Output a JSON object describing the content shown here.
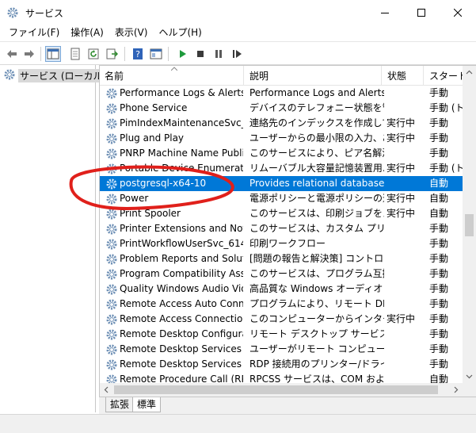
{
  "window": {
    "title": "サービス",
    "accent": "#0078d7"
  },
  "menu": [
    {
      "label": "ファイル(F)",
      "name": "menu-file"
    },
    {
      "label": "操作(A)",
      "name": "menu-action"
    },
    {
      "label": "表示(V)",
      "name": "menu-view"
    },
    {
      "label": "ヘルプ(H)",
      "name": "menu-help"
    }
  ],
  "tree": {
    "root_label": "サービス (ローカル)"
  },
  "columns": {
    "name": "名前",
    "description": "説明",
    "status": "状態",
    "startup": "スタートア"
  },
  "rows": [
    {
      "name": "Performance Logs & Alerts",
      "desc": "Performance Logs and Alerts...",
      "status": "",
      "startup": "手動"
    },
    {
      "name": "Phone Service",
      "desc": "デバイスのテレフォニー状態を管...",
      "status": "",
      "startup": "手動 (ト"
    },
    {
      "name": "PimIndexMaintenanceSvc_6...",
      "desc": "連絡先のインデックスを作成して...",
      "status": "実行中",
      "startup": "手動"
    },
    {
      "name": "Plug and Play",
      "desc": "ユーザーからの最小限の入力、あ...",
      "status": "実行中",
      "startup": "手動"
    },
    {
      "name": "PNRP Machine Name Publi...",
      "desc": "このサービスにより、ピア名解決プ...",
      "status": "",
      "startup": "手動"
    },
    {
      "name": "Portable Device Enumerator...",
      "desc": "リムーバブル大容量記憶装置用...",
      "status": "実行中",
      "startup": "手動 (ト"
    },
    {
      "name": "postgresql-x64-10",
      "desc": "Provides relational database ...",
      "status": "",
      "startup": "自動",
      "selected": true
    },
    {
      "name": "Power",
      "desc": "電源ポリシーと電源ポリシーの通...",
      "status": "実行中",
      "startup": "自動"
    },
    {
      "name": "Print Spooler",
      "desc": "このサービスは、印刷ジョブをスプ...",
      "status": "実行中",
      "startup": "自動"
    },
    {
      "name": "Printer Extensions and Notif...",
      "desc": "このサービスは、カスタム プリンタ...",
      "status": "",
      "startup": "手動"
    },
    {
      "name": "PrintWorkflowUserSvc_61490",
      "desc": "印刷ワークフロー",
      "status": "",
      "startup": "手動"
    },
    {
      "name": "Problem Reports and Soluti...",
      "desc": "[問題の報告と解決策] コントロ...",
      "status": "",
      "startup": "手動"
    },
    {
      "name": "Program Compatibility Assis...",
      "desc": "このサービスは、プログラム互換性...",
      "status": "",
      "startup": "手動"
    },
    {
      "name": "Quality Windows Audio Vid...",
      "desc": "高品質な Windows オーディオ ...",
      "status": "",
      "startup": "手動"
    },
    {
      "name": "Remote Access Auto Conne...",
      "desc": "プログラムにより、リモート DNS 名...",
      "status": "",
      "startup": "手動"
    },
    {
      "name": "Remote Access Connection ...",
      "desc": "このコンピューターからインターネッ...",
      "status": "実行中",
      "startup": "手動"
    },
    {
      "name": "Remote Desktop Configurat...",
      "desc": "リモート デスクトップ サービスとリモ...",
      "status": "",
      "startup": "手動"
    },
    {
      "name": "Remote Desktop Services",
      "desc": "ユーザーがリモート コンピューターに...",
      "status": "",
      "startup": "手動"
    },
    {
      "name": "Remote Desktop Services Us...",
      "desc": "RDP 接続用のプリンター/ドライ...",
      "status": "",
      "startup": "手動"
    },
    {
      "name": "Remote Procedure Call (RPC)",
      "desc": "RPCSS サービスは、COM および...",
      "status": "",
      "startup": "自動"
    }
  ],
  "tabs": [
    {
      "label": "拡張",
      "active": false
    },
    {
      "label": "標準",
      "active": true
    }
  ],
  "annotation": {
    "color": "#e0201b",
    "shape": "ellipse"
  }
}
